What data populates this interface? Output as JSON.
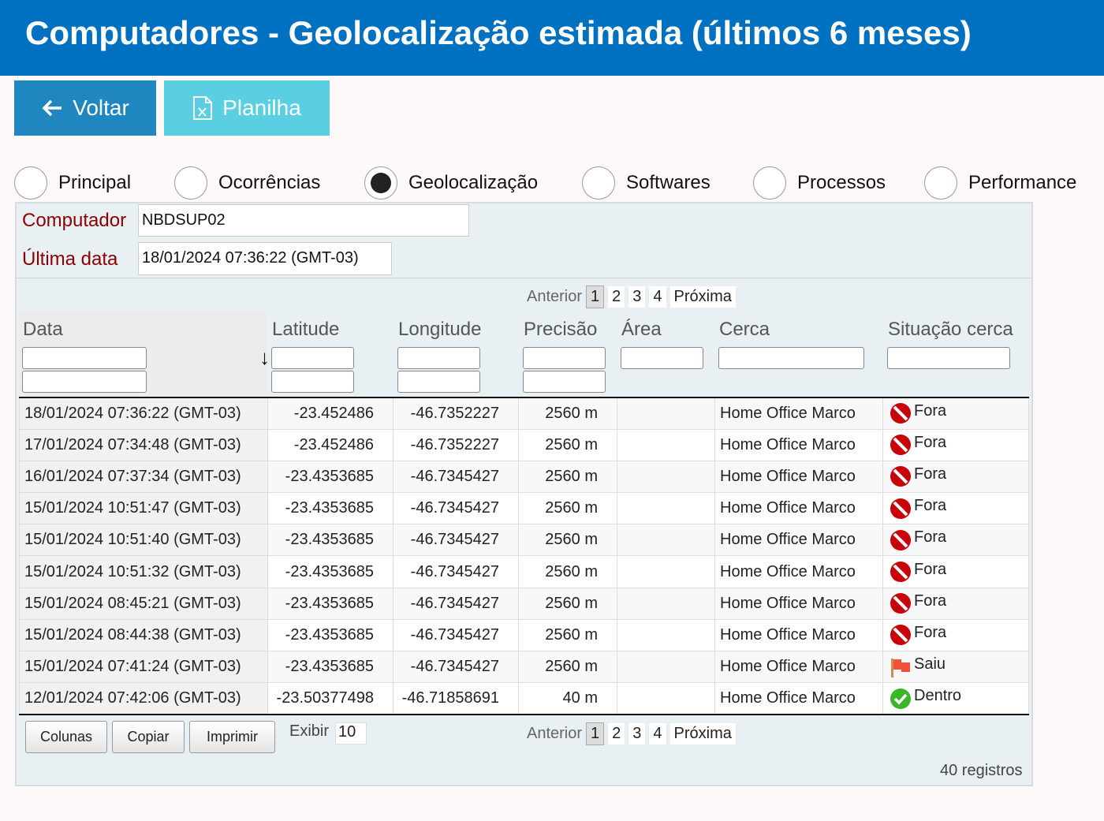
{
  "header": {
    "title": "Computadores - Geolocalização estimada (últimos 6 meses)"
  },
  "toolbar": {
    "back_label": "Voltar",
    "spreadsheet_label": "Planilha"
  },
  "tabs": [
    {
      "label": "Principal",
      "selected": false
    },
    {
      "label": "Ocorrências",
      "selected": false
    },
    {
      "label": "Geolocalização",
      "selected": true
    },
    {
      "label": "Softwares",
      "selected": false
    },
    {
      "label": "Processos",
      "selected": false
    },
    {
      "label": "Performance",
      "selected": false
    }
  ],
  "info": {
    "computer_label": "Computador",
    "computer_value": "NBDSUP02",
    "last_date_label": "Última data",
    "last_date_value": "18/01/2024 07:36:22 (GMT-03)"
  },
  "pager": {
    "prev": "Anterior",
    "pages": [
      "1",
      "2",
      "3",
      "4"
    ],
    "current": "1",
    "next": "Próxima"
  },
  "table": {
    "columns": [
      "Data",
      "Latitude",
      "Longitude",
      "Precisão",
      "Área",
      "Cerca",
      "Situação cerca"
    ],
    "sort_indicator": "↓",
    "rows": [
      {
        "data": "18/01/2024 07:36:22 (GMT-03)",
        "lat": "-23.452486",
        "lon": "-46.7352227",
        "prec": "2560 m",
        "area": "",
        "cerca": "Home Office Marco",
        "sit": "Fora",
        "icon": "no-entry-icon"
      },
      {
        "data": "17/01/2024 07:34:48 (GMT-03)",
        "lat": "-23.452486",
        "lon": "-46.7352227",
        "prec": "2560 m",
        "area": "",
        "cerca": "Home Office Marco",
        "sit": "Fora",
        "icon": "no-entry-icon"
      },
      {
        "data": "16/01/2024 07:37:34 (GMT-03)",
        "lat": "-23.4353685",
        "lon": "-46.7345427",
        "prec": "2560 m",
        "area": "",
        "cerca": "Home Office Marco",
        "sit": "Fora",
        "icon": "no-entry-icon"
      },
      {
        "data": "15/01/2024 10:51:47 (GMT-03)",
        "lat": "-23.4353685",
        "lon": "-46.7345427",
        "prec": "2560 m",
        "area": "",
        "cerca": "Home Office Marco",
        "sit": "Fora",
        "icon": "no-entry-icon"
      },
      {
        "data": "15/01/2024 10:51:40 (GMT-03)",
        "lat": "-23.4353685",
        "lon": "-46.7345427",
        "prec": "2560 m",
        "area": "",
        "cerca": "Home Office Marco",
        "sit": "Fora",
        "icon": "no-entry-icon"
      },
      {
        "data": "15/01/2024 10:51:32 (GMT-03)",
        "lat": "-23.4353685",
        "lon": "-46.7345427",
        "prec": "2560 m",
        "area": "",
        "cerca": "Home Office Marco",
        "sit": "Fora",
        "icon": "no-entry-icon"
      },
      {
        "data": "15/01/2024 08:45:21 (GMT-03)",
        "lat": "-23.4353685",
        "lon": "-46.7345427",
        "prec": "2560 m",
        "area": "",
        "cerca": "Home Office Marco",
        "sit": "Fora",
        "icon": "no-entry-icon"
      },
      {
        "data": "15/01/2024 08:44:38 (GMT-03)",
        "lat": "-23.4353685",
        "lon": "-46.7345427",
        "prec": "2560 m",
        "area": "",
        "cerca": "Home Office Marco",
        "sit": "Fora",
        "icon": "no-entry-icon"
      },
      {
        "data": "15/01/2024 07:41:24 (GMT-03)",
        "lat": "-23.4353685",
        "lon": "-46.7345427",
        "prec": "2560 m",
        "area": "",
        "cerca": "Home Office Marco",
        "sit": "Saiu",
        "icon": "red-flag-icon"
      },
      {
        "data": "12/01/2024 07:42:06 (GMT-03)",
        "lat": "-23.50377498",
        "lon": "-46.71858691",
        "prec": "40 m",
        "area": "",
        "cerca": "Home Office Marco",
        "sit": "Dentro",
        "icon": "check-circle-icon"
      }
    ]
  },
  "footer": {
    "columns_btn": "Colunas",
    "copy_btn": "Copiar",
    "print_btn": "Imprimir",
    "show_label": "Exibir",
    "show_value": "10",
    "records": "40 registros"
  }
}
